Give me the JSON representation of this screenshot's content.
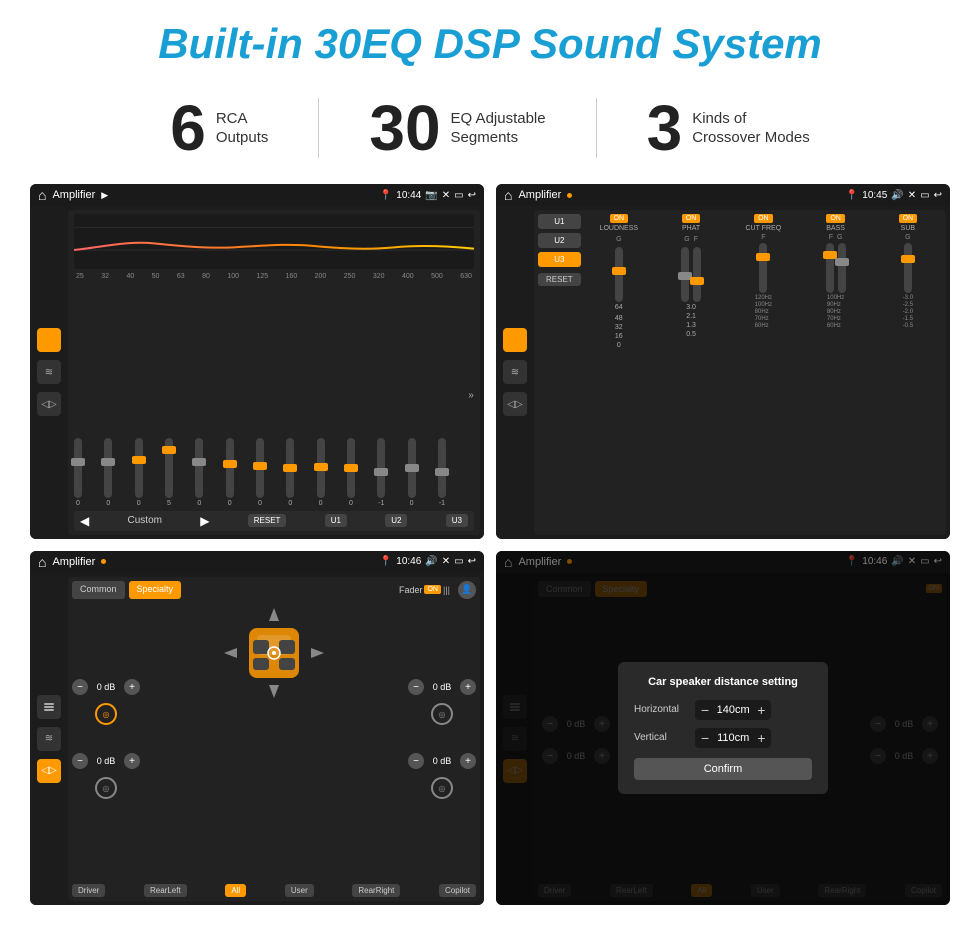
{
  "header": {
    "title": "Built-in 30EQ DSP Sound System"
  },
  "stats": [
    {
      "number": "6",
      "line1": "RCA",
      "line2": "Outputs"
    },
    {
      "number": "30",
      "line1": "EQ Adjustable",
      "line2": "Segments"
    },
    {
      "number": "3",
      "line1": "Kinds of",
      "line2": "Crossover Modes"
    }
  ],
  "screens": [
    {
      "id": "eq-screen",
      "statusBar": {
        "title": "Amplifier",
        "time": "10:44"
      },
      "type": "eq",
      "freqLabels": [
        "25",
        "32",
        "40",
        "50",
        "63",
        "80",
        "100",
        "125",
        "160",
        "200",
        "250",
        "320",
        "400",
        "500",
        "630"
      ],
      "sliderValues": [
        "0",
        "0",
        "0",
        "5",
        "0",
        "0",
        "0",
        "0",
        "0",
        "0",
        "-1",
        "0",
        "-1"
      ],
      "presets": [
        "Custom",
        "RESET",
        "U1",
        "U2",
        "U3"
      ],
      "activePreset": "Custom"
    },
    {
      "id": "dsp-screen",
      "statusBar": {
        "title": "Amplifier",
        "time": "10:45"
      },
      "type": "dsp",
      "channels": [
        "LOUDNESS",
        "PHAT",
        "CUT FREQ",
        "BASS",
        "SUB"
      ],
      "presets": [
        "U1",
        "U2",
        "U3"
      ],
      "activePreset": "U3"
    },
    {
      "id": "fader-screen",
      "statusBar": {
        "title": "Amplifier",
        "time": "10:46"
      },
      "type": "fader",
      "tabs": [
        "Common",
        "Specialty"
      ],
      "activeTab": "Specialty",
      "faderLabel": "Fader",
      "faderOn": "ON",
      "dbValues": [
        "0 dB",
        "0 dB",
        "0 dB",
        "0 dB"
      ],
      "zoneButtons": [
        "Driver",
        "RearLeft",
        "All",
        "User",
        "RearRight",
        "Copilot"
      ],
      "activeZone": "All"
    },
    {
      "id": "distance-screen",
      "statusBar": {
        "title": "Amplifier",
        "time": "10:46"
      },
      "type": "fader-dialog",
      "tabs": [
        "Common",
        "Specialty"
      ],
      "activeTab": "Specialty",
      "dialog": {
        "title": "Car speaker distance setting",
        "rows": [
          {
            "label": "Horizontal",
            "value": "140cm"
          },
          {
            "label": "Vertical",
            "value": "110cm"
          }
        ],
        "confirmLabel": "Confirm"
      },
      "zoneButtons": [
        "Driver",
        "RearLeft",
        "All",
        "User",
        "RearRight",
        "Copilot"
      ]
    }
  ]
}
